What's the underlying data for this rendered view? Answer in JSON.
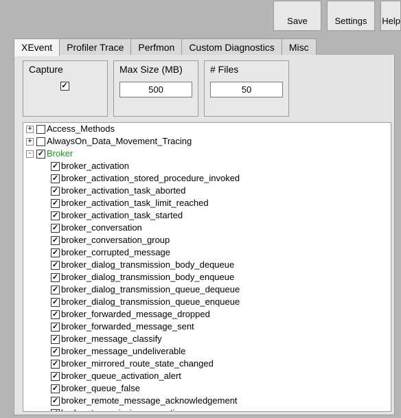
{
  "toolbar": {
    "save": "Save",
    "settings": "Settings",
    "help": "Help"
  },
  "tabs": [
    {
      "label": "XEvent",
      "active": true
    },
    {
      "label": "Profiler Trace",
      "active": false
    },
    {
      "label": "Perfmon",
      "active": false
    },
    {
      "label": "Custom Diagnostics",
      "active": false
    },
    {
      "label": "Misc",
      "active": false
    }
  ],
  "groups": {
    "capture": {
      "label": "Capture",
      "checked": true
    },
    "maxsize": {
      "label": "Max Size (MB)",
      "value": "500"
    },
    "files": {
      "label": "# Files",
      "value": "50"
    }
  },
  "tree": [
    {
      "label": "Access_Methods",
      "checked": false,
      "expander": "+",
      "children": []
    },
    {
      "label": "AlwaysOn_Data_Movement_Tracing",
      "checked": false,
      "expander": "+",
      "children": []
    },
    {
      "label": "Broker",
      "checked": true,
      "expander": "-",
      "selected": true,
      "children": [
        {
          "label": "broker_activation",
          "checked": true
        },
        {
          "label": "broker_activation_stored_procedure_invoked",
          "checked": true
        },
        {
          "label": "broker_activation_task_aborted",
          "checked": true
        },
        {
          "label": "broker_activation_task_limit_reached",
          "checked": true
        },
        {
          "label": "broker_activation_task_started",
          "checked": true
        },
        {
          "label": "broker_conversation",
          "checked": true
        },
        {
          "label": "broker_conversation_group",
          "checked": true
        },
        {
          "label": "broker_corrupted_message",
          "checked": true
        },
        {
          "label": "broker_dialog_transmission_body_dequeue",
          "checked": true
        },
        {
          "label": "broker_dialog_transmission_body_enqueue",
          "checked": true
        },
        {
          "label": "broker_dialog_transmission_queue_dequeue",
          "checked": true
        },
        {
          "label": "broker_dialog_transmission_queue_enqueue",
          "checked": true
        },
        {
          "label": "broker_forwarded_message_dropped",
          "checked": true
        },
        {
          "label": "broker_forwarded_message_sent",
          "checked": true
        },
        {
          "label": "broker_message_classify",
          "checked": true
        },
        {
          "label": "broker_message_undeliverable",
          "checked": true
        },
        {
          "label": "broker_mirrored_route_state_changed",
          "checked": true
        },
        {
          "label": "broker_queue_activation_alert",
          "checked": true
        },
        {
          "label": "broker_queue_false",
          "checked": true
        },
        {
          "label": "broker_remote_message_acknowledgement",
          "checked": true
        },
        {
          "label": "broker_transmission_exception",
          "checked": true
        }
      ]
    }
  ]
}
